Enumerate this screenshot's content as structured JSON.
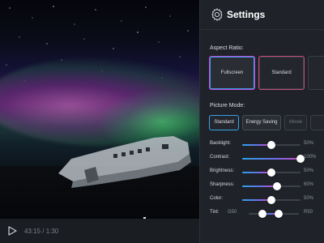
{
  "panel": {
    "title": "Settings",
    "aspect_ratio_label": "Aspect Ratio:",
    "aspect_options": [
      {
        "label": "Fullscreen",
        "selected": true
      },
      {
        "label": "Standard",
        "selected": false
      },
      {
        "label": "",
        "selected": false
      }
    ],
    "picture_mode_label": "Picture Mode:",
    "picture_modes": [
      {
        "label": "Standard",
        "selected": true
      },
      {
        "label": "Energy Saving",
        "selected": false
      },
      {
        "label": "Movie",
        "selected": false
      },
      {
        "label": "",
        "selected": false
      }
    ],
    "sliders": [
      {
        "label": "Backlight:",
        "value_text": "50%",
        "value": 0.5
      },
      {
        "label": "Contrast:",
        "value_text": "100%",
        "value": 1.0
      },
      {
        "label": "Brightness:",
        "value_text": "50%",
        "value": 0.5
      },
      {
        "label": "Sharpness:",
        "value_text": "60%",
        "value": 0.6
      },
      {
        "label": "Color:",
        "value_text": "50%",
        "value": 0.5
      }
    ],
    "tint": {
      "label": "Tint:",
      "left": "G50",
      "right": "R50",
      "value_low": 0.28,
      "value_high": 0.6
    }
  },
  "player": {
    "time": "43:15 / 1:30",
    "progress": 0.72
  },
  "colors": {
    "accent_blue": "#29a3ea",
    "accent_pink": "#d24cc9"
  }
}
